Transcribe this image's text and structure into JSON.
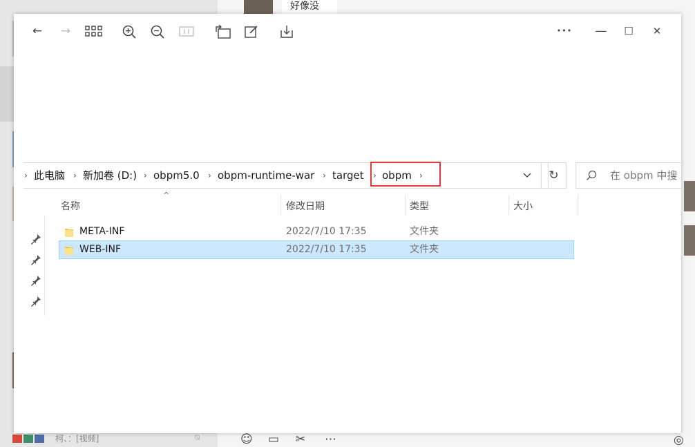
{
  "background_chat": {
    "bubble_text": "好像没",
    "last_message": "柯、：[视频]"
  },
  "toolbar": {
    "back_label": "←",
    "forward_label": "→",
    "more_label": "•••",
    "minimize_label": "—",
    "maximize_label": "☐",
    "close_label": "✕"
  },
  "address_bar": {
    "breadcrumbs": [
      "此电脑",
      "新加卷 (D:)",
      "obpm5.0",
      "obpm-runtime-war",
      "target",
      "obpm"
    ],
    "highlighted": "obpm"
  },
  "search": {
    "placeholder": "在 obpm 中搜"
  },
  "columns": {
    "name": "名称",
    "date": "修改日期",
    "type": "类型",
    "size": "大小"
  },
  "files": [
    {
      "name": "META-INF",
      "modified": "2022/7/10 17:35",
      "type": "文件夹",
      "selected": false
    },
    {
      "name": "WEB-INF",
      "modified": "2022/7/10 17:35",
      "type": "文件夹",
      "selected": true
    }
  ],
  "colors": {
    "selection_fill": "#cce8ff",
    "selection_border": "#99d1ff",
    "highlight_box": "#e53935",
    "folder": "#f5c542"
  }
}
